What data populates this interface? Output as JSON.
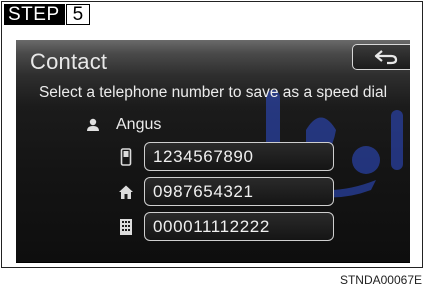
{
  "step": {
    "label": "STEP",
    "number": "5"
  },
  "screen": {
    "title": "Contact",
    "prompt": "Select a telephone number to save as a speed dial",
    "contact_name": "Angus",
    "numbers": [
      {
        "icon": "mobile-phone-icon",
        "value": "1234567890"
      },
      {
        "icon": "home-icon",
        "value": "0987654321"
      },
      {
        "icon": "office-building-icon",
        "value": "000011112222"
      }
    ]
  },
  "figure_code": "STNDA00067E",
  "colors": {
    "screen_bg": "#141414",
    "text": "#ececec",
    "button_border": "#cfcfcf",
    "watermark": "#2f4fd1"
  }
}
